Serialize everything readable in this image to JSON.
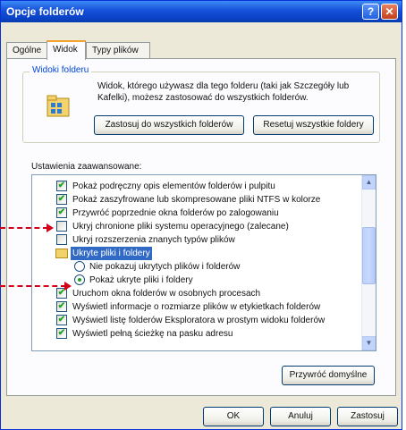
{
  "window": {
    "title": "Opcje folderów",
    "help_label": "?",
    "close_label": "✕"
  },
  "tabs": [
    {
      "label": "Ogólne"
    },
    {
      "label": "Widok"
    },
    {
      "label": "Typy plików"
    }
  ],
  "folder_views": {
    "group_label": "Widoki folderu",
    "description": "Widok, którego używasz dla tego folderu (taki jak Szczegóły lub Kafelki), możesz zastosować do wszystkich folderów.",
    "apply_button": "Zastosuj do wszystkich folderów",
    "reset_button": "Resetuj wszystkie foldery"
  },
  "advanced": {
    "label": "Ustawienia zaawansowane:",
    "items": [
      {
        "type": "checkbox",
        "checked": true,
        "text": "Pokaż podręczny opis elementów folderów i pulpitu"
      },
      {
        "type": "checkbox",
        "checked": true,
        "text": "Pokaż zaszyfrowane lub skompresowane pliki NTFS w kolorze"
      },
      {
        "type": "checkbox",
        "checked": true,
        "text": "Przywróć poprzednie okna folderów po zalogowaniu"
      },
      {
        "type": "checkbox",
        "checked": false,
        "text": "Ukryj chronione pliki systemu operacyjnego (zalecane)"
      },
      {
        "type": "checkbox",
        "checked": false,
        "text": "Ukryj rozszerzenia znanych typów plików"
      },
      {
        "type": "folder",
        "text": "Ukryte pliki i foldery"
      },
      {
        "type": "radio",
        "checked": false,
        "text": "Nie pokazuj ukrytych plików i folderów"
      },
      {
        "type": "radio",
        "checked": true,
        "text": "Pokaż ukryte pliki i foldery"
      },
      {
        "type": "checkbox",
        "checked": true,
        "text": "Uruchom okna folderów w osobnych procesach"
      },
      {
        "type": "checkbox",
        "checked": true,
        "text": "Wyświetl informacje o rozmiarze plików w etykietkach folderów"
      },
      {
        "type": "checkbox",
        "checked": true,
        "text": "Wyświetl listę folderów Eksploratora w prostym widoku folderów"
      },
      {
        "type": "checkbox",
        "checked": true,
        "text": "Wyświetl pełną ścieżkę na pasku adresu"
      }
    ],
    "restore_button": "Przywróć domyślne"
  },
  "dialog_buttons": {
    "ok": "OK",
    "cancel": "Anuluj",
    "apply": "Zastosuj"
  },
  "colors": {
    "title_bar": "#0a43c8",
    "selection": "#316ac5",
    "check": "#21a121",
    "annotation_arrow": "#d4001a"
  }
}
